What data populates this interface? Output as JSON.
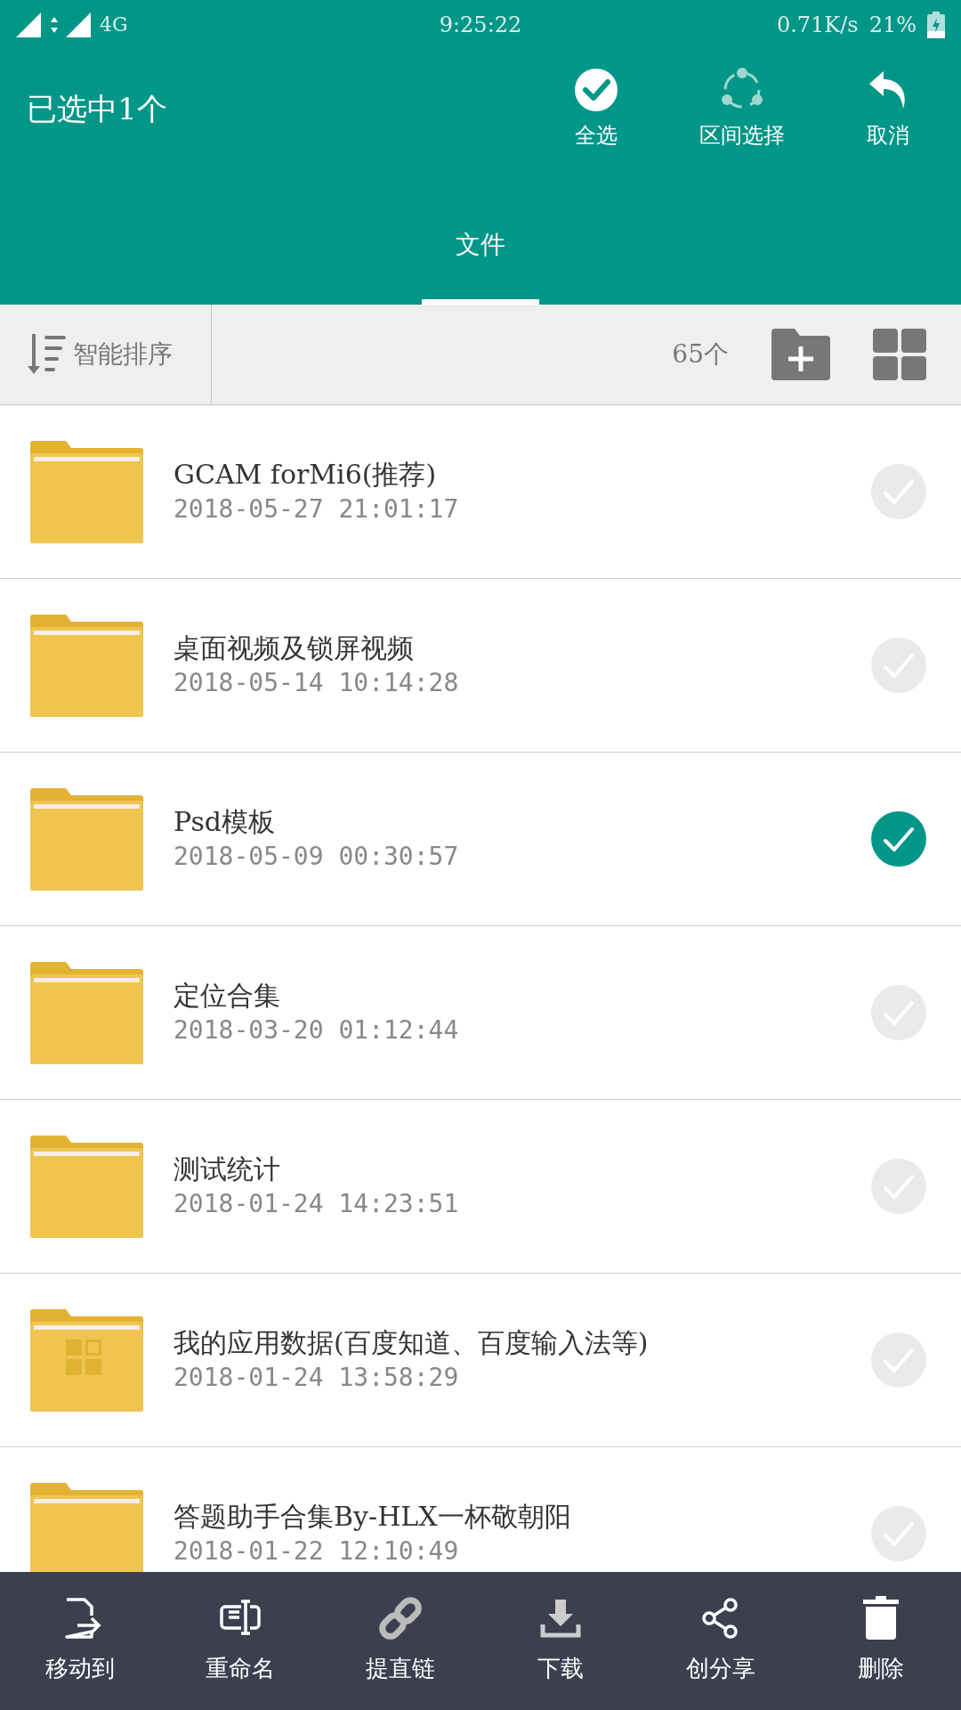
{
  "status_bar": {
    "network": "4G",
    "time": "9:25:22",
    "speed": "0.71K/s",
    "battery": "21%"
  },
  "header": {
    "title": "已选中1个",
    "actions": [
      {
        "kind": "select-all",
        "label": "全选"
      },
      {
        "kind": "range",
        "label": "区间选择"
      },
      {
        "kind": "cancel",
        "label": "取消"
      }
    ]
  },
  "tabs": [
    {
      "label": "文件",
      "selected": true
    }
  ],
  "toolbar": {
    "sort": "智能排序",
    "count": "65个"
  },
  "files": [
    {
      "kind": "folder",
      "name": "GCAM forMi6(推荐)",
      "date": "2018-05-27 21:01:17",
      "selected": false
    },
    {
      "kind": "folder",
      "name": "桌面视频及锁屏视频",
      "date": "2018-05-14 10:14:28",
      "selected": false
    },
    {
      "kind": "folder",
      "name": "Psd模板",
      "date": "2018-05-09 00:30:57",
      "selected": true
    },
    {
      "kind": "folder",
      "name": "定位合集",
      "date": "2018-03-20 01:12:44",
      "selected": false
    },
    {
      "kind": "folder",
      "name": "测试统计",
      "date": "2018-01-24 14:23:51",
      "selected": false
    },
    {
      "kind": "app-folder",
      "name": "我的应用数据(百度知道、百度输入法等)",
      "date": "2018-01-24 13:58:29",
      "selected": false
    },
    {
      "kind": "folder",
      "name": "答题助手合集By-HLX一杯敬朝阳",
      "date": "2018-01-22 12:10:49",
      "selected": false
    }
  ],
  "bottom_bar": [
    {
      "kind": "move",
      "label": "移动到"
    },
    {
      "kind": "rename",
      "label": "重命名"
    },
    {
      "kind": "link",
      "label": "提直链"
    },
    {
      "kind": "download",
      "label": "下载"
    },
    {
      "kind": "share",
      "label": "创分享"
    },
    {
      "kind": "delete",
      "label": "删除"
    }
  ]
}
